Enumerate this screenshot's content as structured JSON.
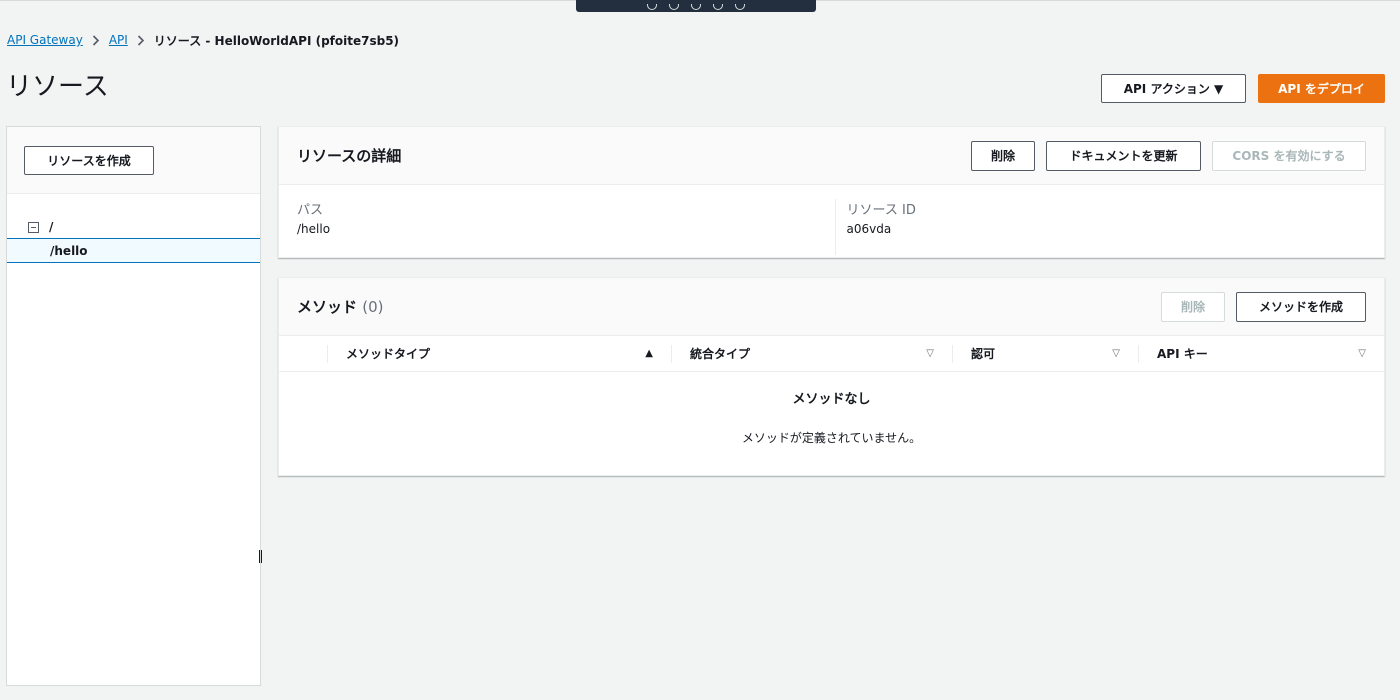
{
  "breadcrumb": {
    "items": [
      "API Gateway",
      "API"
    ],
    "current": "リソース - HelloWorldAPI (pfoite7sb5)"
  },
  "page": {
    "title": "リソース"
  },
  "header_actions": {
    "api_actions_label": "API アクション ▼",
    "deploy_label": "API をデプロイ"
  },
  "sidebar": {
    "create_resource_label": "リソースを作成",
    "tree": {
      "root": "/",
      "children": [
        "/hello"
      ]
    }
  },
  "details": {
    "title": "リソースの詳細",
    "delete_label": "削除",
    "update_doc_label": "ドキュメントを更新",
    "cors_label": "CORS を有効にする",
    "path_label": "パス",
    "path_value": "/hello",
    "resource_id_label": "リソース ID",
    "resource_id_value": "a06vda"
  },
  "methods": {
    "title": "メソッド",
    "count": "(0)",
    "delete_label": "削除",
    "create_label": "メソッドを作成",
    "columns": [
      "メソッドタイプ",
      "統合タイプ",
      "認可",
      "API キー"
    ],
    "empty_title": "メソッドなし",
    "empty_desc": "メソッドが定義されていません。"
  },
  "colors": {
    "accent": "#ec7211",
    "link": "#0073bb",
    "background": "#f2f3f3"
  }
}
